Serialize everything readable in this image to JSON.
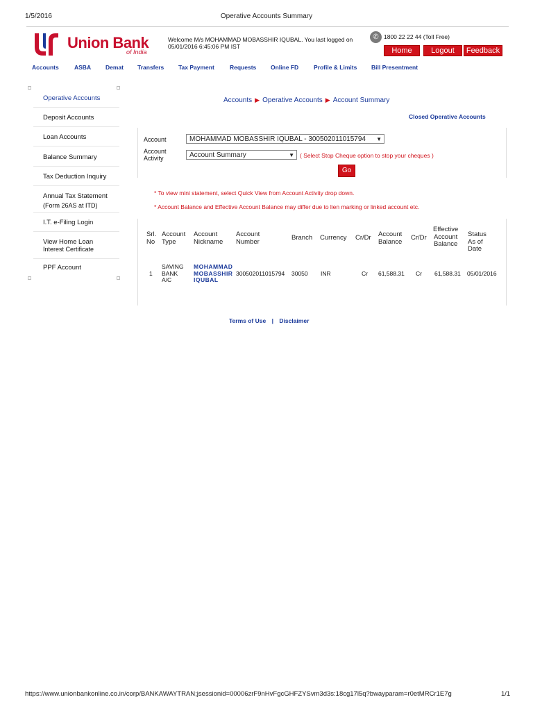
{
  "print_header": {
    "date": "1/5/2016",
    "title": "Operative Accounts Summary"
  },
  "brand": {
    "name": "Union Bank",
    "sub": "of India",
    "color": "#c8102e"
  },
  "welcome": {
    "line1": "Welcome M/s MOHAMMAD MOBASSHIR IQUBAL.  You last logged on",
    "line2": "05/01/2016 6:45:06 PM IST"
  },
  "tollfree": "1800 22 22 44 (Toll Free)",
  "top_buttons": {
    "home": "Home",
    "logout": "Logout",
    "feedback": "Feedback"
  },
  "nav": [
    "Accounts",
    "ASBA",
    "Demat",
    "Transfers",
    "Tax Payment",
    "Requests",
    "Online FD",
    "Profile & Limits",
    "Bill Presentment"
  ],
  "sidebar": [
    {
      "label": "Operative Accounts"
    },
    {
      "label": "Deposit Accounts"
    },
    {
      "label": "Loan Accounts"
    },
    {
      "label": "Balance Summary"
    },
    {
      "label": "Tax Deduction Inquiry"
    },
    {
      "label": "Annual Tax Statement",
      "label2": "(Form 26AS at ITD)"
    },
    {
      "label": "I.T. e-Filing Login"
    },
    {
      "label": "View Home Loan",
      "label2": "Interest Certificate"
    },
    {
      "label": "PPF Account"
    }
  ],
  "breadcrumb": [
    "Accounts",
    "Operative Accounts",
    "Account Summary"
  ],
  "closed_link": "Closed Operative Accounts",
  "form": {
    "account_label": "Account",
    "account_value": "MOHAMMAD MOBASSHIR IQUBAL - 300502011015794",
    "activity_label1": "Account",
    "activity_label2": "Activity",
    "activity_value": "Account Summary",
    "activity_hint": "( Select Stop Cheque option to stop your cheques )",
    "go": "Go"
  },
  "notes": [
    "* To view mini statement, select Quick View from Account Activity drop down.",
    "* Account Balance and Effective Account Balance may differ due to lien marking or linked account etc."
  ],
  "table": {
    "headers": [
      [
        "Srl.",
        "No"
      ],
      [
        "Account",
        "Type"
      ],
      [
        "Account",
        "Nickname"
      ],
      [
        "Account",
        "Number"
      ],
      [
        "Branch"
      ],
      [
        "Currency"
      ],
      [
        "Cr/Dr"
      ],
      [
        "Account",
        "Balance"
      ],
      [
        "Cr/Dr"
      ],
      [
        "Effective",
        "Account",
        "Balance"
      ],
      [
        "Status",
        "As of",
        "Date"
      ]
    ],
    "rows": [
      {
        "srl": "1",
        "type": [
          "SAVING",
          "BANK",
          "A/C"
        ],
        "nickname": [
          "MOHAMMAD",
          "MOBASSHIR",
          "IQUBAL"
        ],
        "number": "300502011015794",
        "branch": "30050",
        "currency": "INR",
        "crdr1": "Cr",
        "balance": "61,588.31",
        "crdr2": "Cr",
        "eff_balance": "61,588.31",
        "date": "05/01/2016"
      }
    ]
  },
  "footer": {
    "terms": "Terms of Use",
    "sep": "|",
    "disclaimer": "Disclaimer"
  },
  "print_footer": {
    "url": "https://www.unionbankonline.co.in/corp/BANKAWAYTRAN;jsessionid=00006zrF9nHvFgcGHFZYSvm3d3s:18cg17l5q?bwayparam=r0etMRCr1E7g",
    "page": "1/1"
  }
}
